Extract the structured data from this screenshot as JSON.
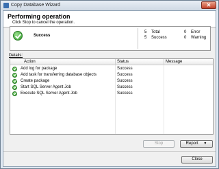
{
  "window": {
    "title": "Copy Database Wizard",
    "close_glyph": "✕"
  },
  "header": {
    "title": "Performing operation",
    "subtitle": "Click Stop to cancel the operation."
  },
  "summary": {
    "status": "Success",
    "total_count": "5",
    "total_label": "Total",
    "success_count": "5",
    "success_label": "Success",
    "error_count": "0",
    "error_label": "Error",
    "warning_count": "0",
    "warning_label": "Warning"
  },
  "details": {
    "label": "Details:",
    "columns": [
      "Action",
      "Status",
      "Message"
    ],
    "rows": [
      {
        "action": "Add log for package",
        "status": "Success",
        "message": ""
      },
      {
        "action": "Add task for transferring database objects",
        "status": "Success",
        "message": ""
      },
      {
        "action": "Create package",
        "status": "Success",
        "message": ""
      },
      {
        "action": "Start SQL Server Agent Job",
        "status": "Success",
        "message": ""
      },
      {
        "action": "Execute SQL Server Agent Job",
        "status": "Success",
        "message": ""
      }
    ]
  },
  "buttons": {
    "stop": "Stop",
    "report": "Report",
    "report_arrow": "▼",
    "close": "Close"
  },
  "colors": {
    "success_green": "#2e9a2a",
    "title_bar": "#dfe8f2"
  }
}
